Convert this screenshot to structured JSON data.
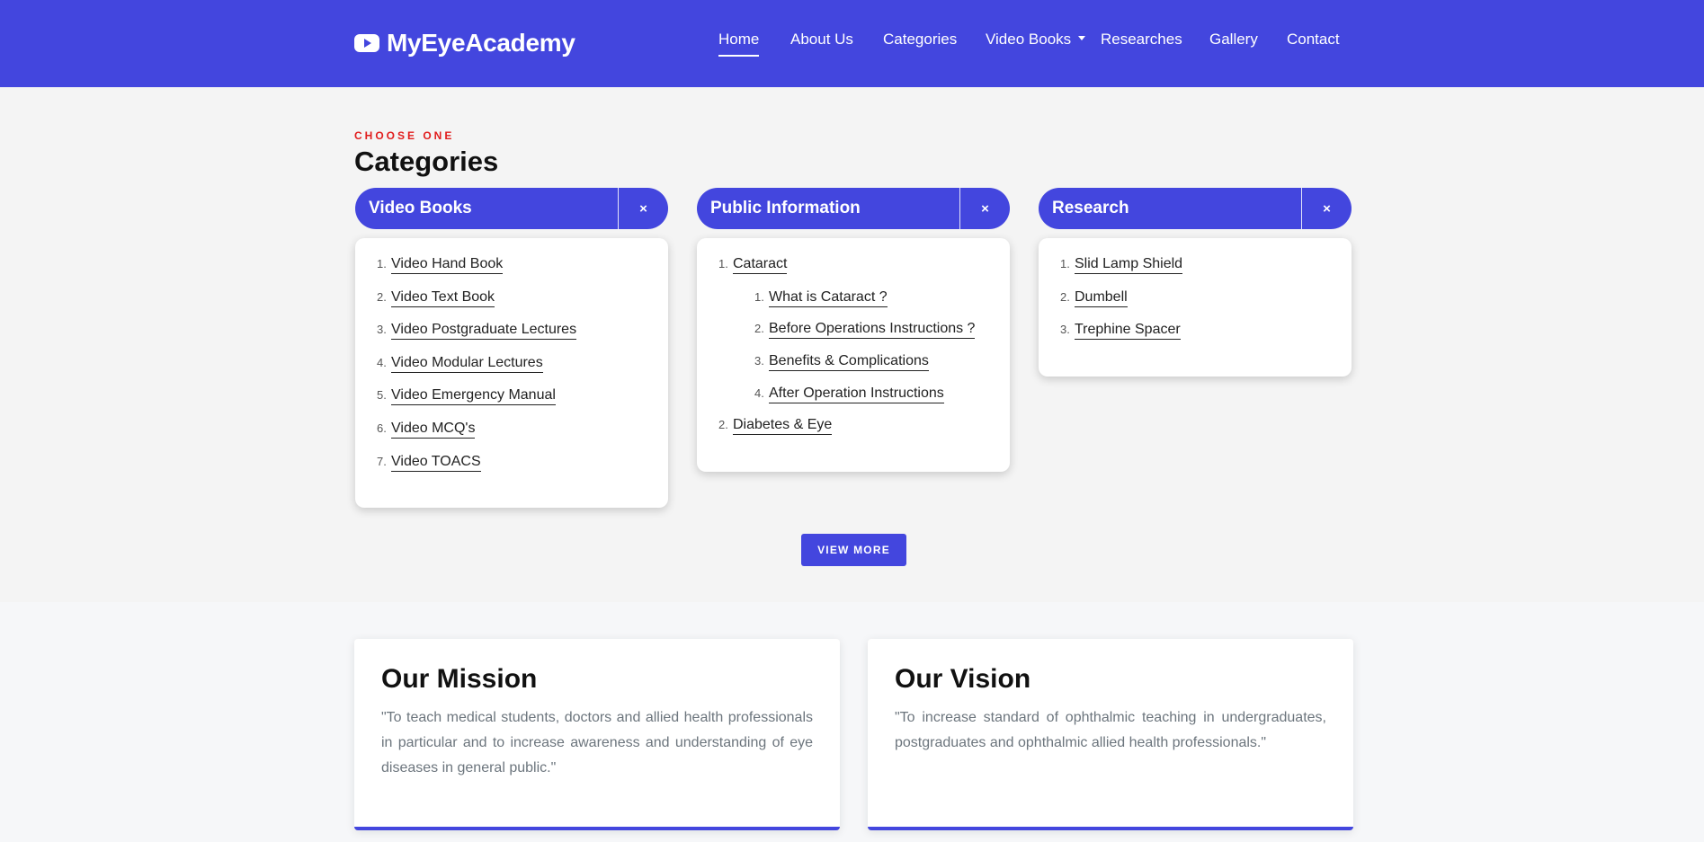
{
  "brand": {
    "name": "MyEyeAcademy",
    "logo_icon": "youtube-icon"
  },
  "nav": [
    {
      "label": "Home",
      "active": true
    },
    {
      "label": "About Us"
    },
    {
      "label": "Categories"
    },
    {
      "label": "Video Books",
      "dropdown": true
    },
    {
      "label": "Researches"
    },
    {
      "label": "Gallery"
    },
    {
      "label": "Contact"
    }
  ],
  "categories": {
    "eyebrow": "CHOOSE ONE",
    "title": "Categories",
    "close_symbol": "×",
    "columns": [
      {
        "title": "Video Books",
        "items": [
          {
            "num": "1.",
            "label": "Video Hand Book"
          },
          {
            "num": "2.",
            "label": "Video Text Book"
          },
          {
            "num": "3.",
            "label": "Video Postgraduate Lectures"
          },
          {
            "num": "4.",
            "label": "Video Modular Lectures"
          },
          {
            "num": "5.",
            "label": "Video Emergency Manual"
          },
          {
            "num": "6.",
            "label": "Video MCQ's"
          },
          {
            "num": "7.",
            "label": "Video TOACS"
          }
        ]
      },
      {
        "title": "Public Information",
        "items": [
          {
            "num": "1.",
            "label": "Cataract",
            "children": [
              {
                "num": "1.",
                "label": "What is Cataract ?"
              },
              {
                "num": "2.",
                "label": "Before Operations Instructions ?"
              },
              {
                "num": "3.",
                "label": "Benefits & Complications"
              },
              {
                "num": "4.",
                "label": "After Operation Instructions"
              }
            ]
          },
          {
            "num": "2.",
            "label": "Diabetes & Eye"
          }
        ]
      },
      {
        "title": "Research",
        "items": [
          {
            "num": "1.",
            "label": "Slid Lamp Shield"
          },
          {
            "num": "2.",
            "label": "Dumbell"
          },
          {
            "num": "3.",
            "label": "Trephine Spacer"
          }
        ]
      }
    ],
    "view_more": "VIEW MORE"
  },
  "mission": {
    "title": "Our Mission",
    "text": "\"To teach medical students, doctors and allied health professionals in particular and to increase awareness and understanding of eye diseases in general public.\""
  },
  "vision": {
    "title": "Our Vision",
    "text": "\"To increase standard of ophthalmic teaching in undergraduates, postgraduates and ophthalmic allied health professionals.\""
  },
  "colors": {
    "primary": "#4346de",
    "eyebrow": "#e11d1d",
    "page_bg": "#f4f4f4"
  }
}
